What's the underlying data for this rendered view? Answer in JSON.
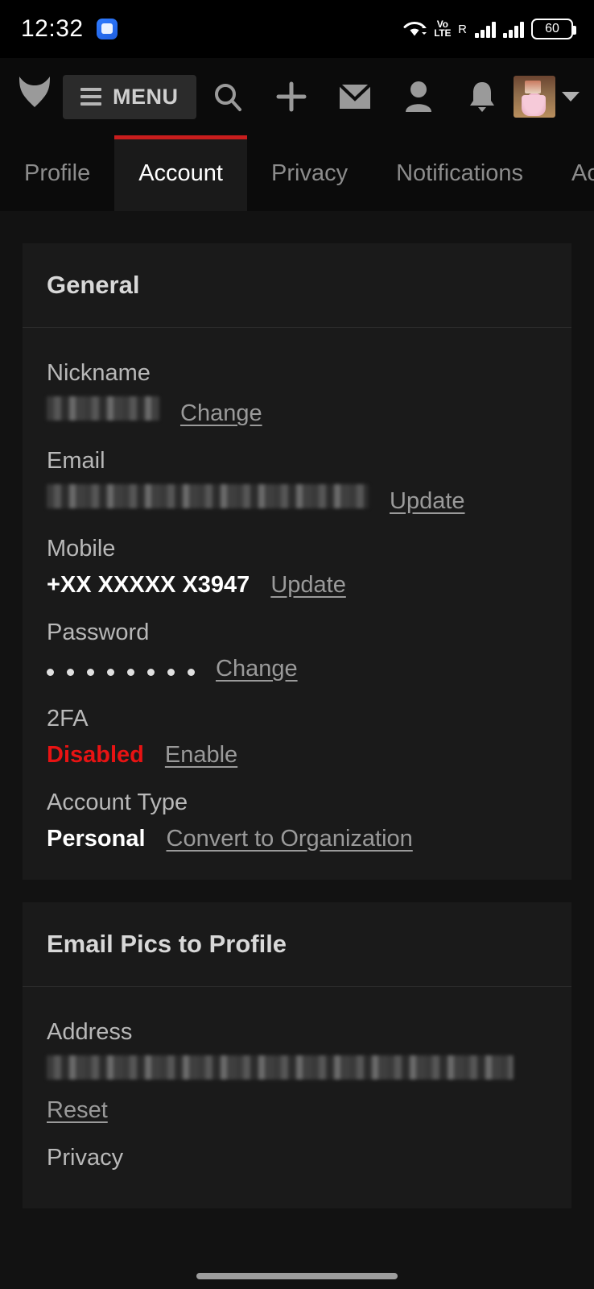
{
  "colors": {
    "accent": "#c81d1d",
    "danger": "#e81313",
    "page_bg": "#121212",
    "card_bg": "#1a1a1a"
  },
  "status_bar": {
    "time": "12:32",
    "app_icon": "message-app-icon",
    "wifi_icon": "wifi-icon",
    "volte_line1": "Vo",
    "volte_line2": "LTE",
    "roaming_label": "R",
    "signal_1_icon": "signal-bars-icon",
    "signal_2_icon": "signal-bars-icon",
    "battery_level": "60"
  },
  "topnav": {
    "logo_icon": "fox-head-logo",
    "menu_label": "MENU",
    "hamburger_icon": "hamburger-icon",
    "icons": [
      {
        "name": "search-icon"
      },
      {
        "name": "plus-icon"
      },
      {
        "name": "envelope-icon"
      },
      {
        "name": "person-icon"
      },
      {
        "name": "bell-icon"
      }
    ],
    "avatar": "user-avatar",
    "caret": "chevron-down-icon"
  },
  "tabs": [
    {
      "label": "Profile",
      "active": false
    },
    {
      "label": "Account",
      "active": true
    },
    {
      "label": "Privacy",
      "active": false
    },
    {
      "label": "Notifications",
      "active": false
    },
    {
      "label": "Activi",
      "active": false
    }
  ],
  "sections": [
    {
      "title": "General",
      "fields": [
        {
          "label": "Nickname",
          "value": "",
          "redacted": true,
          "action": "Change"
        },
        {
          "label": "Email",
          "value": "",
          "redacted": true,
          "action": "Update"
        },
        {
          "label": "Mobile",
          "value": "+XX XXXXX X3947",
          "bold": true,
          "action": "Update"
        },
        {
          "label": "Password",
          "value": "••••••••",
          "dots": 8,
          "action": "Change"
        },
        {
          "label": "2FA",
          "value": "Disabled",
          "danger": true,
          "action": "Enable"
        },
        {
          "label": "Account Type",
          "value": "Personal",
          "bold": true,
          "action": "Convert to Organization"
        }
      ]
    },
    {
      "title": "Email Pics to Profile",
      "fields": [
        {
          "label": "Address",
          "value": "",
          "redacted": true,
          "action": "Reset"
        },
        {
          "label": "Privacy",
          "value": "",
          "action": ""
        }
      ]
    }
  ]
}
